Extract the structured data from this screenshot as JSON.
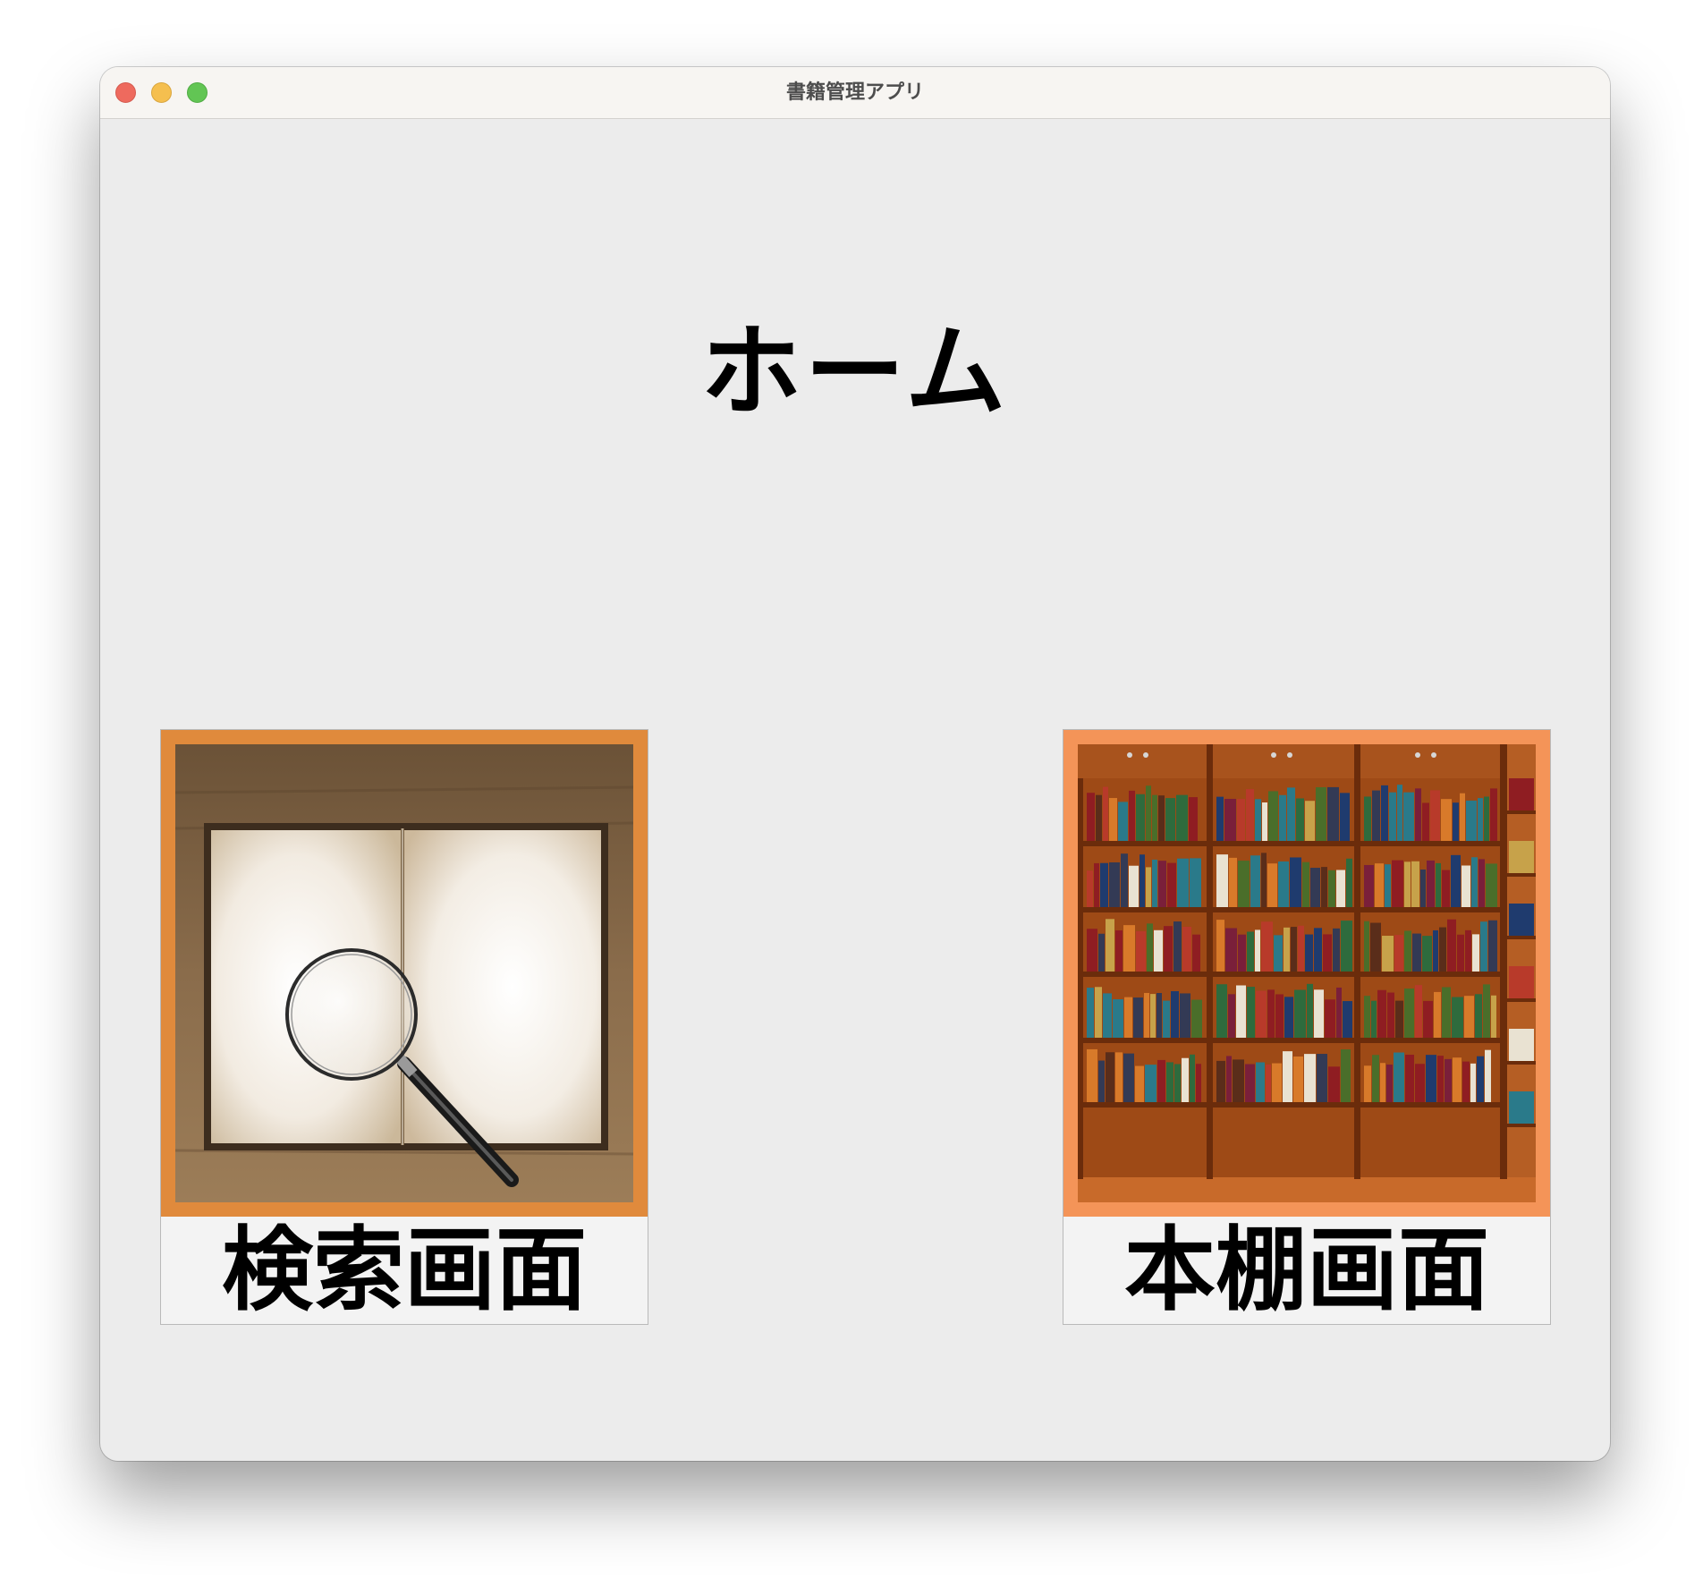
{
  "window": {
    "title": "書籍管理アプリ",
    "controls": [
      "close",
      "minimize",
      "maximize"
    ]
  },
  "main": {
    "heading": "ホーム",
    "buttons": [
      {
        "label": "検索画面",
        "icon": "magnifier-over-book-image",
        "frame_color": "#e08a3c"
      },
      {
        "label": "本棚画面",
        "icon": "bookshelf-image",
        "frame_color": "#f49458"
      }
    ]
  }
}
